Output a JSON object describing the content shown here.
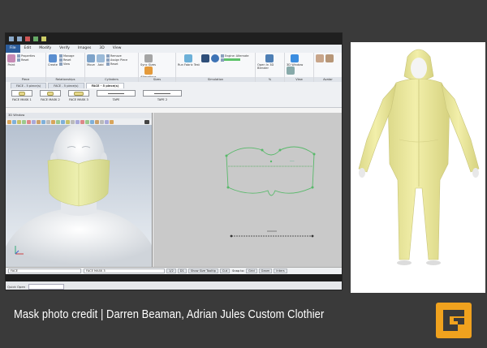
{
  "menu": [
    "File",
    "Edit",
    "Modify",
    "Verify",
    "Images",
    "3D",
    "View"
  ],
  "ribbon": {
    "groups": [
      {
        "label": "Piece",
        "buttons": [
          "Paint"
        ],
        "small": [
          "Properties",
          "Reset"
        ]
      },
      {
        "label": "Relationships",
        "buttons": [
          "Create"
        ],
        "small": [
          "Manage",
          "Reset",
          "View"
        ]
      },
      {
        "label": "Cylinders",
        "buttons": [
          "Move",
          "Add"
        ],
        "small": [
          "Remove",
          "Assign Piece",
          "Reset"
        ]
      },
      {
        "label": "Sizes",
        "buttons": [
          "Sync Sizes",
          "Alterations"
        ],
        "small": []
      },
      {
        "label": "Simulation",
        "buttons": [
          "Run Fabric Test"
        ],
        "small": [
          "Engine: Alternate"
        ]
      },
      {
        "label": "%",
        "buttons": [
          "Open In 3D Blender",
          "Sync 3D Changes"
        ],
        "small": []
      },
      {
        "label": "View",
        "buttons": [
          "3D Window",
          "Create Mesh"
        ],
        "small": []
      },
      {
        "label": "Avatar",
        "buttons": [
          "Body Positions",
          "Avatar Editor"
        ],
        "small": []
      }
    ]
  },
  "piece_tabs": [
    "FACE - 5 piece(s)",
    "FACE - 5 piece(s)",
    "FACE - 5 piece(s)"
  ],
  "pieces": [
    {
      "name": "FACE MASK 1"
    },
    {
      "name": "FACE MASK 2"
    },
    {
      "name": "FACE MASK 3"
    },
    {
      "name": "TAPE"
    },
    {
      "name": "TAPE 2"
    }
  ],
  "window3d_title": "3D Window",
  "status": {
    "field1": "FACE",
    "field2": "FACE MASK 3",
    "zoom": "1/2",
    "units": "D1",
    "tooltip_btn": "Show Size Tooltip",
    "cut_btn": "Cut",
    "snap_to": "Snap to:",
    "grid": "Grid",
    "geom": "Geom",
    "inters": "Inters"
  },
  "quick_open_label": "Quick Open",
  "caption": "Mask photo credit | Darren Beaman, Adrian Jules Custom Clothier",
  "colors": {
    "logo": "#f0a21e",
    "mask": "#e9eaa4",
    "coverall": "#eeeb9f",
    "pattern_line": "#58b96a",
    "accent": "#2c5d9c"
  }
}
